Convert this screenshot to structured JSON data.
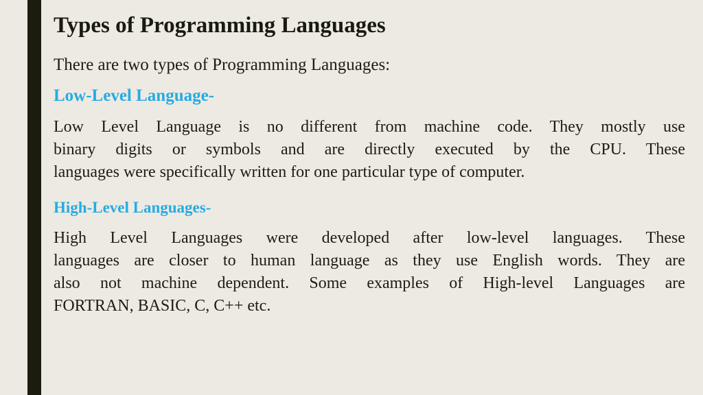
{
  "slide": {
    "title": "Types of Programming Languages",
    "intro": "There are two types of Programming Languages:",
    "sections": [
      {
        "heading": "Low-Level Language-",
        "lines": [
          "Low Level Language is no different from machine code. They mostly use",
          "binary digits or symbols and are directly executed by the CPU. These",
          "languages were specifically written for one particular type of computer."
        ]
      },
      {
        "heading": "High-Level Languages-",
        "lines": [
          "High Level Languages were developed after low-level languages. These",
          "languages are closer to human language as they use English words. They are",
          "also not machine dependent. Some examples of High-level Languages are",
          "FORTRAN, BASIC, C, C++ etc."
        ]
      }
    ],
    "colors": {
      "background": "#EDEAE3",
      "accent_bar": "#1B1C0E",
      "heading_cyan": "#26ABE2",
      "body_text": "#1C1C14",
      "title_text": "#1A1A12"
    }
  }
}
